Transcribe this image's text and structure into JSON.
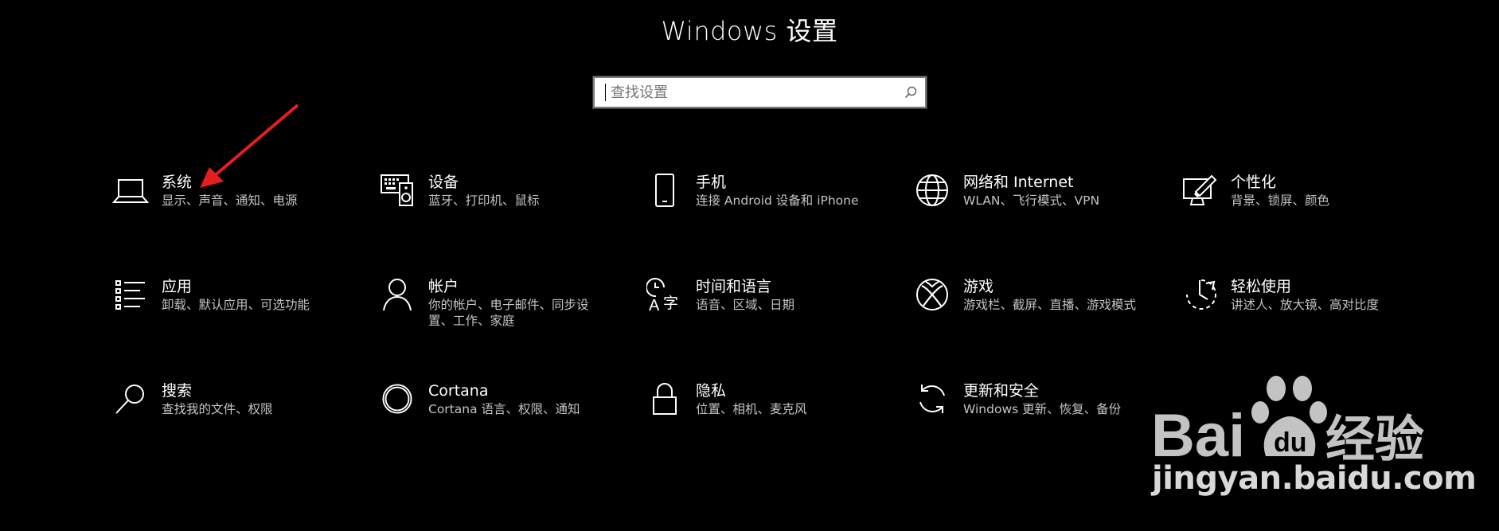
{
  "window": {
    "title": "Windows 设置"
  },
  "search": {
    "placeholder": "查找设置",
    "value": ""
  },
  "tiles": [
    {
      "icon": "laptop-icon",
      "label": "系统",
      "desc": "显示、声音、通知、电源"
    },
    {
      "icon": "keyboard-speaker-icon",
      "label": "设备",
      "desc": "蓝牙、打印机、鼠标"
    },
    {
      "icon": "phone-icon",
      "label": "手机",
      "desc": "连接 Android 设备和 iPhone"
    },
    {
      "icon": "globe-icon",
      "label": "网络和 Internet",
      "desc": "WLAN、飞行模式、VPN"
    },
    {
      "icon": "paint-brush-monitor-icon",
      "label": "个性化",
      "desc": "背景、锁屏、颜色"
    },
    {
      "icon": "app-list-icon",
      "label": "应用",
      "desc": "卸载、默认应用、可选功能"
    },
    {
      "icon": "person-icon",
      "label": "帐户",
      "desc": "你的帐户、电子邮件、同步设置、工作、家庭"
    },
    {
      "icon": "time-language-icon",
      "label": "时间和语言",
      "desc": "语音、区域、日期"
    },
    {
      "icon": "xbox-icon",
      "label": "游戏",
      "desc": "游戏栏、截屏、直播、游戏模式"
    },
    {
      "icon": "ease-of-access-icon",
      "label": "轻松使用",
      "desc": "讲述人、放大镜、高对比度"
    },
    {
      "icon": "search-icon",
      "label": "搜索",
      "desc": "查找我的文件、权限"
    },
    {
      "icon": "cortana-icon",
      "label": "Cortana",
      "desc": "Cortana 语言、权限、通知"
    },
    {
      "icon": "lock-icon",
      "label": "隐私",
      "desc": "位置、相机、麦克风"
    },
    {
      "icon": "sync-icon",
      "label": "更新和安全",
      "desc": "Windows 更新、恢复、备份"
    }
  ],
  "annotation": {
    "color": "#e41f1f"
  },
  "watermark": {
    "logo_text": "Bai 经验",
    "url": "jingyan.baidu.com"
  }
}
